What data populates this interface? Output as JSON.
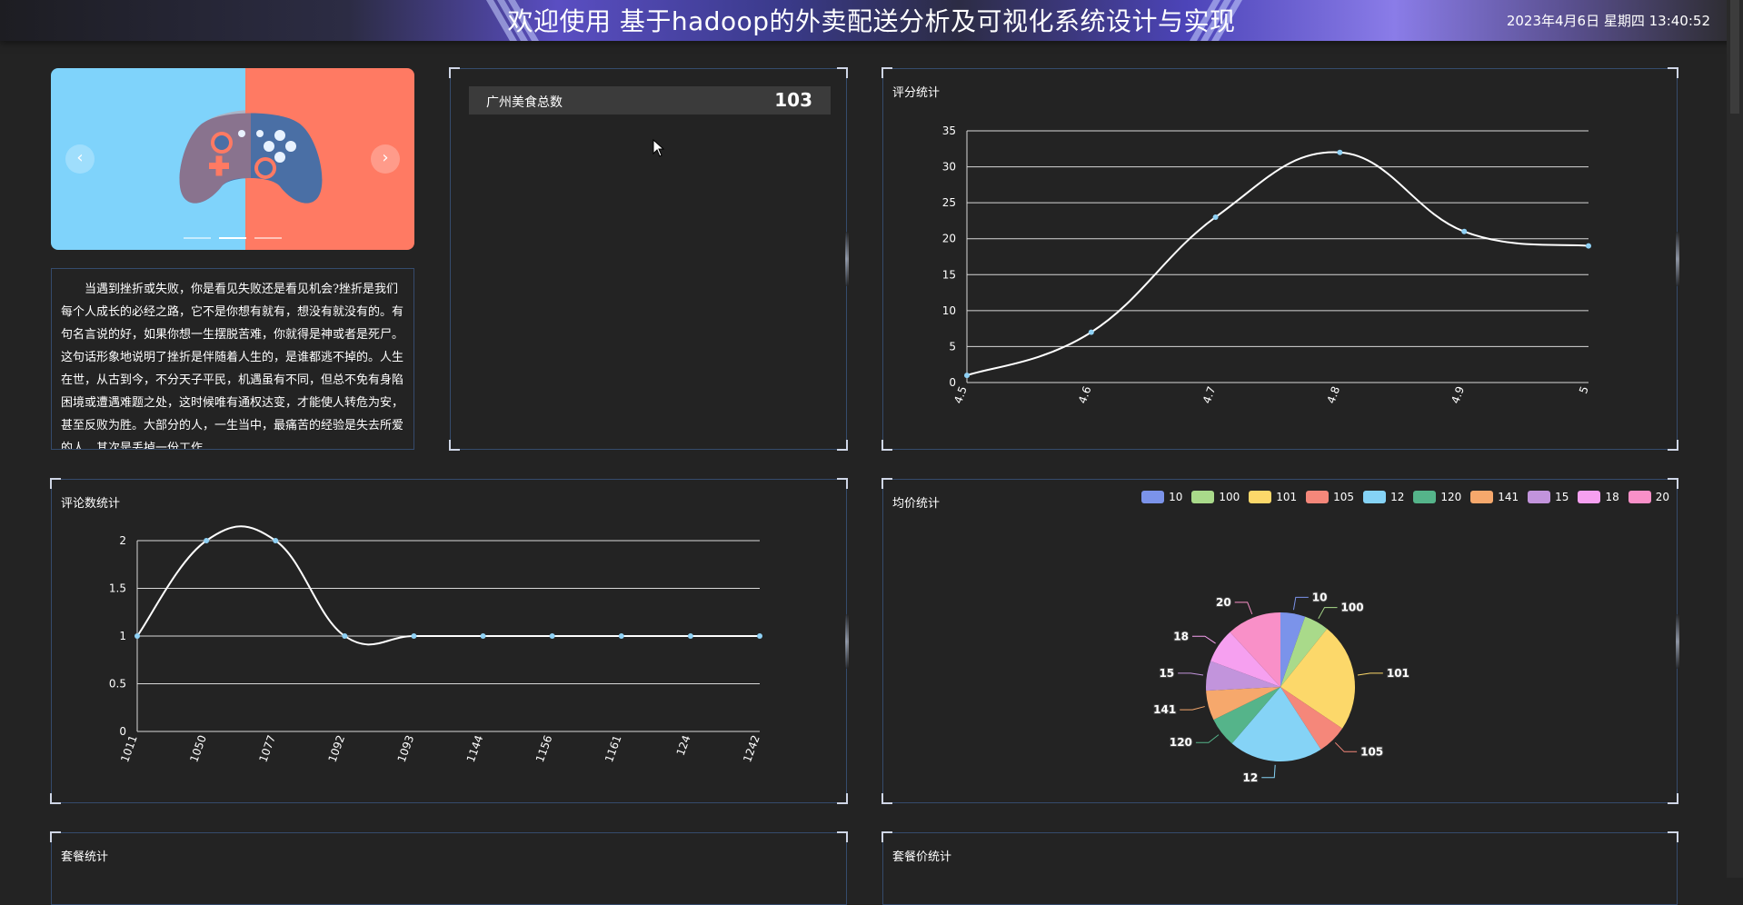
{
  "header": {
    "title": "欢迎使用 基于hadoop的外卖配送分析及可视化系统设计与实现",
    "datetime": "2023年4月6日 星期四 13:40:52"
  },
  "carousel": {
    "prev_icon": "‹",
    "next_icon": "›",
    "slide_count": 3,
    "active_slide": 2,
    "image": "gamepad-icon",
    "colors": {
      "left": "#7fd3fb",
      "right": "#ff7a63",
      "gamepad": "#4a6fa5"
    }
  },
  "intro": {
    "text": "当遇到挫折或失败，你是看见失败还是看见机会?挫折是我们每个人成长的必经之路，它不是你想有就有，想没有就没有的。有句名言说的好，如果你想一生摆脱苦难，你就得是神或者是死尸。这句话形象地说明了挫折是伴随着人生的，是谁都逃不掉的。人生在世，从古到今，不分天子平民，机遇虽有不同，但总不免有身陷困境或遭遇难题之处，这时候唯有通权达变，才能使人转危为安，甚至反败为胜。大部分的人，一生当中，最痛苦的经验是失去所爱的人，其次是丢掉一份工作"
  },
  "total": {
    "label": "广州美食总数",
    "value": "103"
  },
  "rating_chart": {
    "title": "评分统计",
    "chart_data": {
      "type": "line",
      "x": [
        "4.5",
        "4.6",
        "4.7",
        "4.8",
        "4.9",
        "5"
      ],
      "values": [
        1,
        7,
        23,
        32,
        21,
        19
      ],
      "ylim": [
        0,
        35
      ],
      "yticks": [
        "0",
        "5",
        "10",
        "15",
        "20",
        "25",
        "30",
        "35"
      ],
      "smooth": true,
      "grid": true,
      "line_color": "#ffffff",
      "point_color": "#8fd1f5"
    }
  },
  "comments_chart": {
    "title": "评论数统计",
    "chart_data": {
      "type": "line",
      "x": [
        "1011",
        "1050",
        "1077",
        "1092",
        "1093",
        "1144",
        "1156",
        "1161",
        "124",
        "1242"
      ],
      "values": [
        1,
        2,
        2,
        1,
        1,
        1,
        1,
        1,
        1,
        1
      ],
      "ylim": [
        0,
        2
      ],
      "yticks": [
        "0",
        "0.5",
        "1",
        "1.5",
        "2"
      ],
      "smooth": true,
      "grid": true,
      "line_color": "#ffffff",
      "point_color": "#8fd1f5"
    }
  },
  "price_chart": {
    "title": "均价统计",
    "chart_data": {
      "type": "pie",
      "slices": [
        {
          "name": "10",
          "value": 5,
          "color": "#7b93ea"
        },
        {
          "name": "100",
          "value": 5,
          "color": "#a9da8a"
        },
        {
          "name": "101",
          "value": 22,
          "color": "#fcd86a"
        },
        {
          "name": "105",
          "value": 6,
          "color": "#f5877a"
        },
        {
          "name": "12",
          "value": 19,
          "color": "#85d3f6"
        },
        {
          "name": "120",
          "value": 6,
          "color": "#55b48a"
        },
        {
          "name": "141",
          "value": 6,
          "color": "#f6a86c"
        },
        {
          "name": "15",
          "value": 6,
          "color": "#c294dc"
        },
        {
          "name": "18",
          "value": 7,
          "color": "#f6a0f0"
        },
        {
          "name": "20",
          "value": 11,
          "color": "#f990c8"
        }
      ],
      "legend_position": "top-right"
    }
  },
  "package_chart": {
    "title": "套餐统计"
  },
  "package_price_chart": {
    "title": "套餐价统计"
  }
}
